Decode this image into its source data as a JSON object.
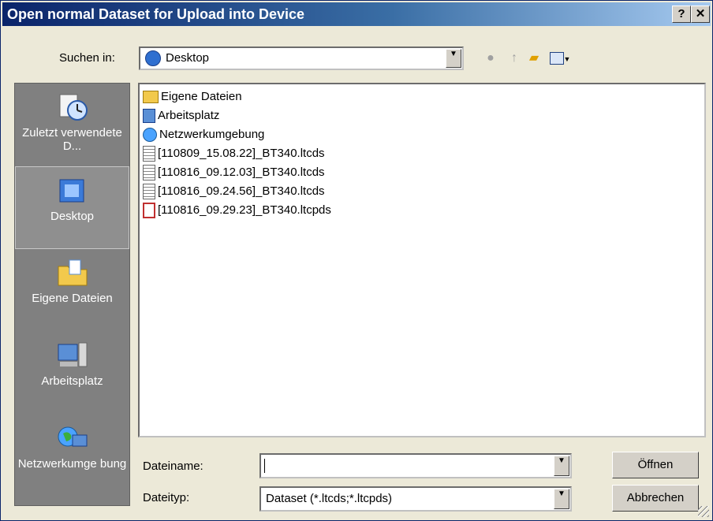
{
  "window": {
    "title": "Open normal Dataset for Upload into Device",
    "help_label": "?",
    "close_label": "✕"
  },
  "lookin": {
    "label": "Suchen in:",
    "value": "Desktop"
  },
  "toolbar": {
    "back_icon": "back-icon",
    "up_icon": "up-folder-icon",
    "new_folder_icon": "new-folder-icon",
    "view_menu_icon": "view-menu-icon"
  },
  "places": [
    {
      "label": "Zuletzt verwendete D...",
      "icon": "recent-icon"
    },
    {
      "label": "Desktop",
      "icon": "desktop-icon"
    },
    {
      "label": "Eigene Dateien",
      "icon": "my-documents-icon"
    },
    {
      "label": "Arbeitsplatz",
      "icon": "my-computer-icon"
    },
    {
      "label": "Netzwerkumge bung",
      "icon": "network-icon"
    }
  ],
  "files": [
    {
      "name": "Eigene Dateien",
      "icon": "folder-icon"
    },
    {
      "name": "Arbeitsplatz",
      "icon": "computer-icon"
    },
    {
      "name": "Netzwerkumgebung",
      "icon": "network-icon"
    },
    {
      "name": "[110809_15.08.22]_BT340.ltcds",
      "icon": "document-icon"
    },
    {
      "name": "[110816_09.12.03]_BT340.ltcds",
      "icon": "document-icon"
    },
    {
      "name": "[110816_09.24.56]_BT340.ltcds",
      "icon": "document-icon"
    },
    {
      "name": "[110816_09.29.23]_BT340.ltcpds",
      "icon": "data-file-icon"
    }
  ],
  "filename": {
    "label": "Dateiname:",
    "value": ""
  },
  "filetype": {
    "label": "Dateityp:",
    "value": "Dataset (*.ltcds;*.ltcpds)"
  },
  "buttons": {
    "open": "Öffnen",
    "cancel": "Abbrechen"
  }
}
